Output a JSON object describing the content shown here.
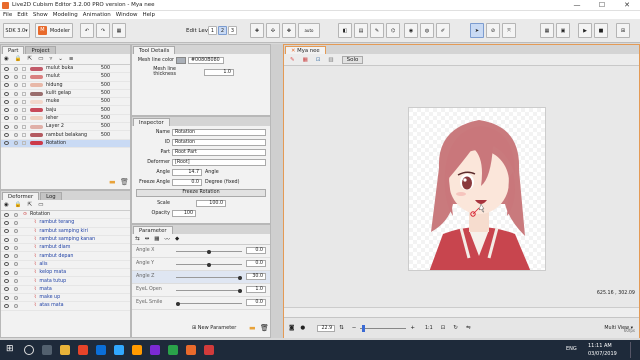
{
  "window": {
    "title": "Live2D Cubism Editor 3.2.00   PRO version - Mya nee",
    "min": "—",
    "max": "☐",
    "close": "✕"
  },
  "menu": [
    "File",
    "Edit",
    "Show",
    "Modeling",
    "Animation",
    "Window",
    "Help"
  ],
  "toolbar": {
    "sdk": "SDK 3.0",
    "mode": "Modeler",
    "edit_level_label": "Edit Level:",
    "levels": [
      "1",
      "2",
      "3"
    ],
    "auto_label": "auto"
  },
  "part_panel": {
    "tabs": [
      "Part",
      "Project"
    ],
    "items": [
      {
        "label": "mulut buka",
        "value": "500",
        "color": "#c25b6a"
      },
      {
        "label": "mulut",
        "value": "500",
        "color": "#d98080"
      },
      {
        "label": "hidung",
        "value": "500",
        "color": "#e8b8a8"
      },
      {
        "label": "kulit gelap",
        "value": "500",
        "color": "#9a6e6e"
      },
      {
        "label": "muke",
        "value": "500",
        "color": "#f2d8cc"
      },
      {
        "label": "baju",
        "value": "500",
        "color": "#c84a5a"
      },
      {
        "label": "leher",
        "value": "500",
        "color": "#f0d0c0"
      },
      {
        "label": "Layer 2",
        "value": "500",
        "color": "#e0b0a8"
      },
      {
        "label": "rambut belakang",
        "value": "500",
        "color": "#b45a60"
      },
      {
        "label": "Rotation",
        "value": "",
        "color": "#cc3a4a"
      }
    ]
  },
  "deformer_panel": {
    "tabs": [
      "Deformer",
      "Log"
    ],
    "items": [
      {
        "label": "Rotation",
        "indent": 0
      },
      {
        "label": "rambut terang",
        "indent": 1
      },
      {
        "label": "rambut samping kiri",
        "indent": 1
      },
      {
        "label": "rambut samping kanan",
        "indent": 1
      },
      {
        "label": "rambut diam",
        "indent": 1
      },
      {
        "label": "rambut depan",
        "indent": 1
      },
      {
        "label": "alis",
        "indent": 1
      },
      {
        "label": "kelop mata",
        "indent": 1
      },
      {
        "label": "mata tutup",
        "indent": 1
      },
      {
        "label": "mata",
        "indent": 1
      },
      {
        "label": "make up",
        "indent": 1
      },
      {
        "label": "atas mata",
        "indent": 1
      }
    ]
  },
  "tool_details": {
    "title": "Tool Details",
    "mesh_color_label": "Mesh line color",
    "mesh_color_value": "#0080B080",
    "mesh_thickness_label": "Mesh line thickness",
    "mesh_thickness_value": "1.0"
  },
  "inspector": {
    "title": "Inspector",
    "name_label": "Name",
    "name_value": "Rotation",
    "id_label": "ID",
    "id_value": "Rotation",
    "part_label": "Part",
    "part_value": "Root Part",
    "deformer_label": "Deformer",
    "deformer_value": "[Root]",
    "angle_label": "Angle",
    "angle_value": "14.7",
    "angle_unit": "Angle",
    "freeze_angle_label": "Freeze Angle",
    "freeze_angle_value": "0.0",
    "freeze_angle_unit": "Degree (fixed)",
    "freeze_rotation_button": "Freeze Rotation",
    "scale_label": "Scale",
    "scale_value": "100.0",
    "opacity_label": "Opacity",
    "opacity_value": "100"
  },
  "parameter_panel": {
    "title": "Parameter",
    "params": [
      {
        "label": "Angle X",
        "value": "0.0",
        "level": 0.5
      },
      {
        "label": "Angle Y",
        "value": "0.0",
        "level": 0.5
      },
      {
        "label": "Angle Z",
        "value": "30.0",
        "level": 1.0
      },
      {
        "label": "EyeL Open",
        "value": "1.0",
        "level": 1.0
      },
      {
        "label": "EyeL Smile",
        "value": "0.0",
        "level": 0.0
      }
    ],
    "new_param_button": "New Parameter"
  },
  "viewport": {
    "tab_label": "Mya nee",
    "solo_label": "Solo",
    "coords": "625.16 , 302.09",
    "zoom": "22.9",
    "ratio": "1:1",
    "view_mode": "Multi View",
    "fps": "60fps"
  },
  "taskbar": {
    "time": "11:11 AM",
    "date": "03/07/2019",
    "lang": "ENG"
  }
}
